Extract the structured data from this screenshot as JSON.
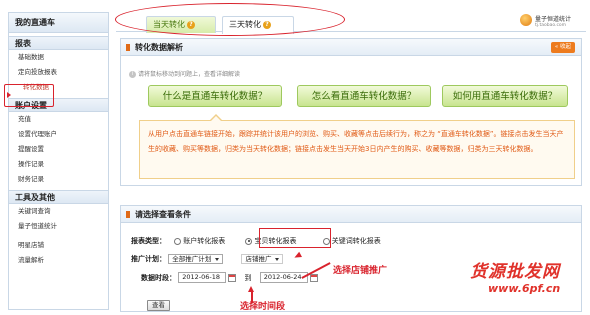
{
  "sidebar": {
    "title": "我的直通车",
    "sections": [
      {
        "heading": "报表",
        "items": [
          "基础数据",
          "定向投放报表",
          "转化数据"
        ]
      },
      {
        "heading": "账户设置",
        "items": [
          "充值",
          "设置代理账户",
          "提醒设置",
          "操作记录",
          "财务记录"
        ]
      },
      {
        "heading": "工具及其他",
        "items": [
          "关键词查询",
          "量子恒道统计",
          "明星店铺",
          "流量解析"
        ]
      }
    ],
    "active_item": "转化数据"
  },
  "tabs": [
    {
      "label": "当天转化",
      "selected": false
    },
    {
      "label": "三天转化",
      "selected": true
    }
  ],
  "brand": {
    "name": "量子恒道统计",
    "url": "tj.taobao.com"
  },
  "panel1": {
    "title": "转化数据解析",
    "collapse_label": "收起",
    "hint": "请将鼠标移动到问题上，查看详细解读",
    "buttons": [
      "什么是直通车转化数据？",
      "怎么看直通车转化数据？",
      "如何用直通车转化数据？"
    ],
    "callout": "从用户点击直通车链接开始，跟踪并统计该用户的浏览、购买、收藏等点击后续行为，称之为 “直通车转化数据”。链接点击发生当天产生的收藏、购买等数据，归类为当天转化数据；链接点击发生当天开始3日内产生的购买、收藏等数据，归类为三天转化数据。"
  },
  "panel2": {
    "title": "请选择查看条件",
    "report_type_label": "报表类型：",
    "report_options": [
      {
        "label": "账户转化报表",
        "checked": false
      },
      {
        "label": "宝贝转化报表",
        "checked": true
      },
      {
        "label": "关键词转化报表",
        "checked": false
      }
    ],
    "plan_label": "推广计划：",
    "plan_value": "全部推广计划",
    "shop_value": "店铺推广",
    "date_label": "数据时段：",
    "date_from": "2012-06-18",
    "date_to_label": "到",
    "date_to": "2012-06-24",
    "query_label": "查看"
  },
  "annotations": {
    "shop": "选择店铺推广",
    "time": "选择时间段"
  },
  "watermark": {
    "text": "货源批发网",
    "url": "www.6pf.cn"
  }
}
